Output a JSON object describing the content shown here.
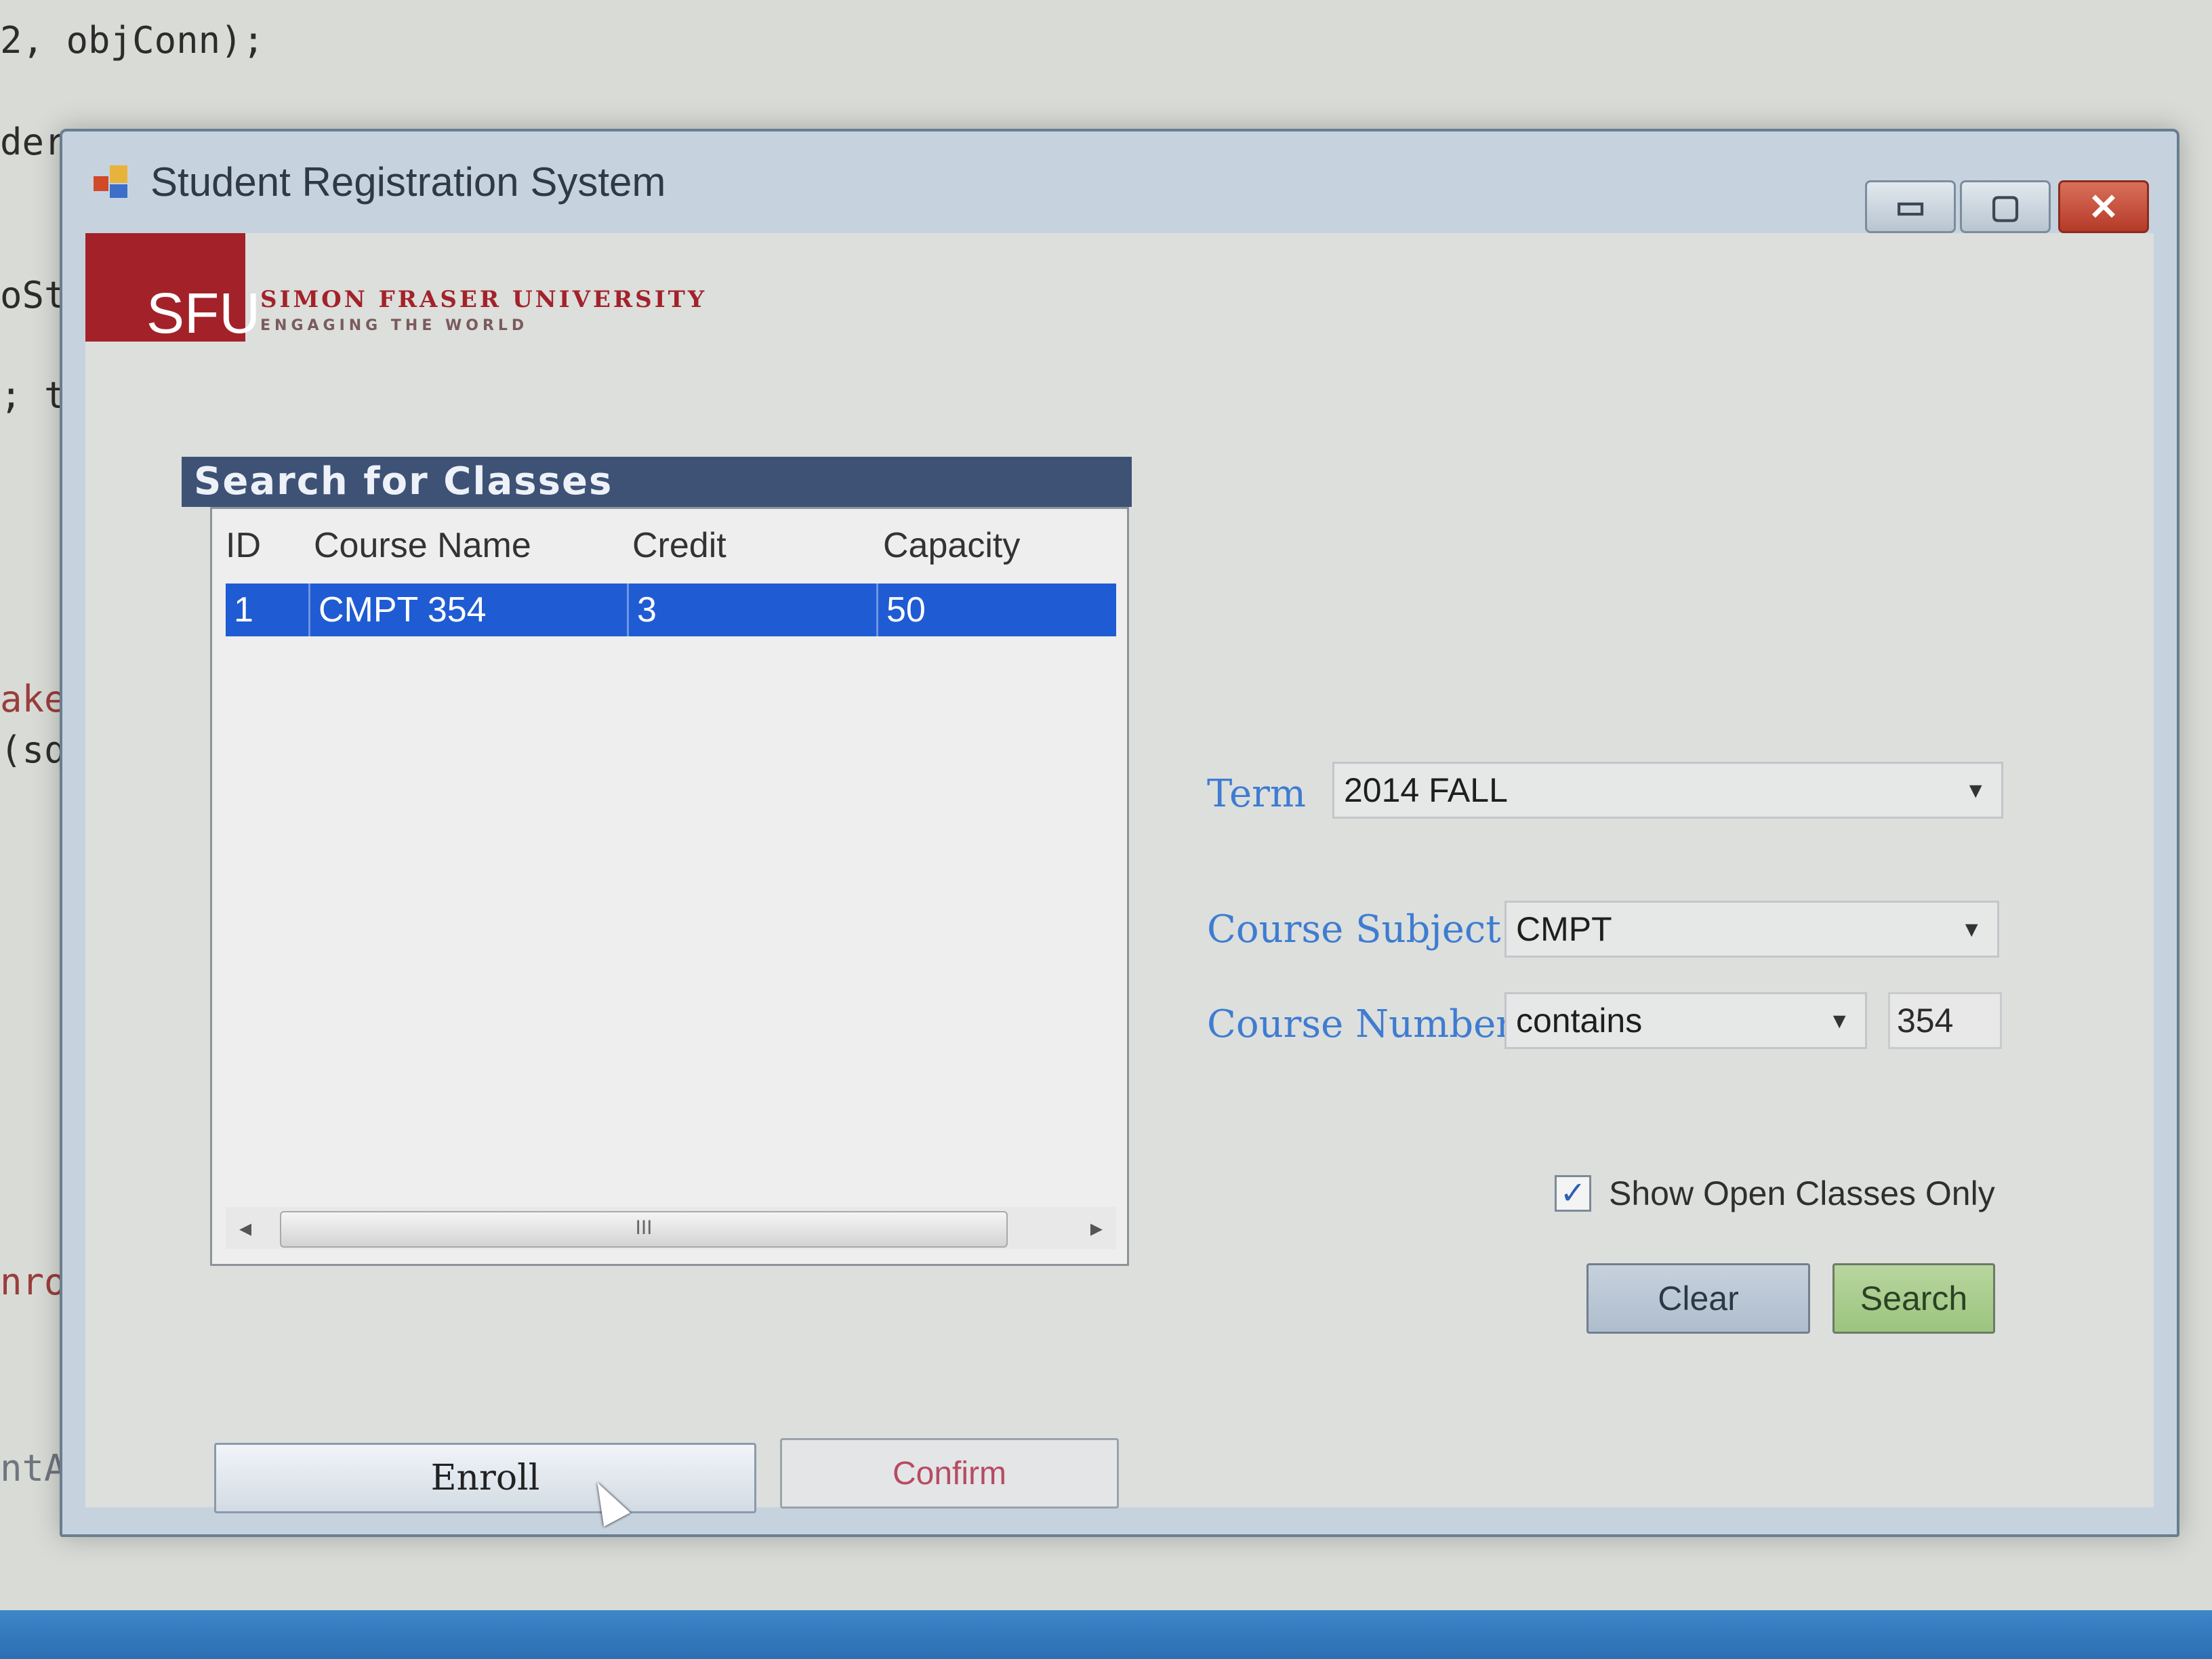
{
  "background_code": {
    "line1": "2, objConn);",
    "line2": "der",
    "line3": "oSt",
    "line4": "; th",
    "line5": "aker",
    "line6": "(sql",
    "line7": "nroll",
    "line8": "ntArgs"
  },
  "window": {
    "title": "Student Registration System",
    "minimize_glyph": "▭",
    "maximize_glyph": "▢",
    "close_glyph": "✕"
  },
  "logo": {
    "mark": "SFU",
    "line1": "SIMON FRASER UNIVERSITY",
    "line2": "ENGAGING THE WORLD",
    "brand_color": "#a3222a"
  },
  "search_panel": {
    "title": "Search for Classes",
    "columns": [
      "ID",
      "Course Name",
      "Credit",
      "Capacity"
    ],
    "rows": [
      {
        "id": "1",
        "course_name": "CMPT 354",
        "credit": "3",
        "capacity": "50"
      }
    ],
    "scroll_thumb": "III",
    "scroll_left": "◂",
    "scroll_right": "▸"
  },
  "form": {
    "term_label": "Term",
    "term_value": "2014 FALL",
    "subject_label": "Course Subject",
    "subject_value": "CMPT",
    "number_label": "Course Number",
    "number_operator": "contains",
    "number_value": "354",
    "open_only_label": "Show Open Classes Only",
    "open_only_checked": true,
    "check_mark": "✓",
    "caret": "▼"
  },
  "buttons": {
    "clear": "Clear",
    "search": "Search",
    "enroll": "Enroll",
    "confirm": "Confirm"
  },
  "colors": {
    "selection": "#1f5bd3",
    "label_blue": "#3f7cd2",
    "panel_header": "#3e5276"
  }
}
